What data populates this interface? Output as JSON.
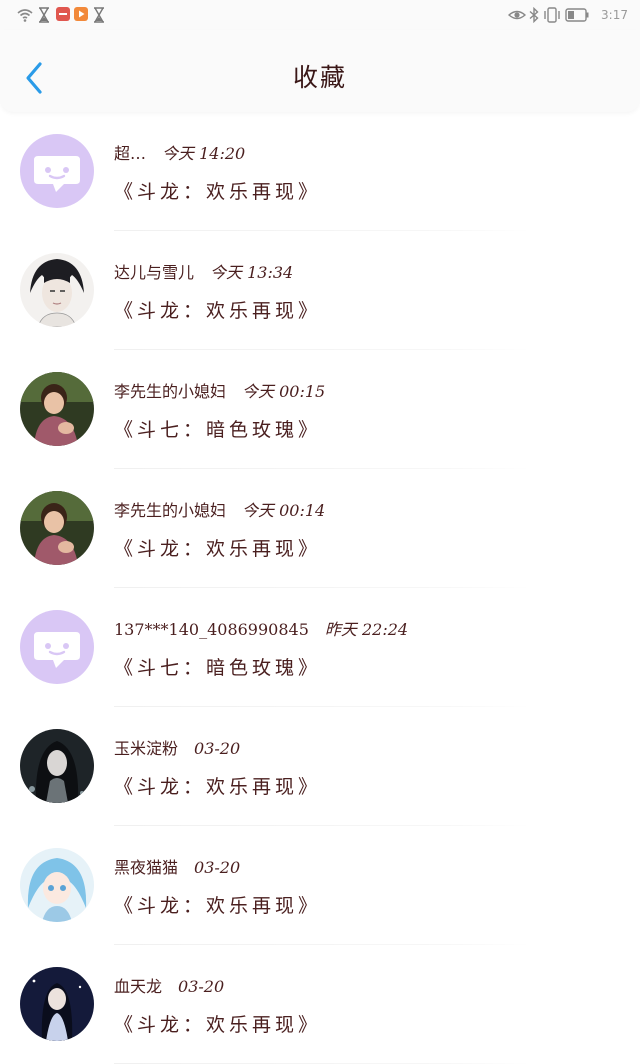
{
  "status_bar": {
    "time": "3:17",
    "icons": [
      "wifi-icon",
      "hourglass-icon",
      "app-red-icon",
      "video-play-icon",
      "hourglass-icon",
      "eye-icon",
      "bluetooth-icon",
      "vibrate-icon",
      "battery-icon"
    ]
  },
  "header": {
    "title": "收藏",
    "back_icon": "chevron-left-icon",
    "back_color": "#2a9be8"
  },
  "colors": {
    "chat_avatar_bg": "#d9c7f5",
    "text": "#4a1f1f"
  },
  "items": [
    {
      "name": "超…",
      "time": "今天 14:20",
      "work": "《斗龙：欢乐再现》",
      "avatar": "chat-bubble-avatar"
    },
    {
      "name": "达儿与雪儿",
      "time": "今天 13:34",
      "work": "《斗龙：欢乐再现》",
      "avatar": "sketch-boy-avatar"
    },
    {
      "name": "李先生的小媳妇",
      "time": "今天 00:15",
      "work": "《斗七：暗色玫瑰》",
      "avatar": "girl-photo-avatar"
    },
    {
      "name": "李先生的小媳妇",
      "time": "今天 00:14",
      "work": "《斗龙：欢乐再现》",
      "avatar": "girl-photo-avatar"
    },
    {
      "name": "137***140_4086990845",
      "time": "昨天 22:24",
      "work": "《斗七：暗色玫瑰》",
      "avatar": "chat-bubble-avatar"
    },
    {
      "name": "玉米淀粉",
      "time": "03-20",
      "work": "《斗龙：欢乐再现》",
      "avatar": "dark-anime-avatar"
    },
    {
      "name": "黑夜猫猫",
      "time": "03-20",
      "work": "《斗龙：欢乐再现》",
      "avatar": "blue-anime-avatar"
    },
    {
      "name": "血天龙",
      "time": "03-20",
      "work": "《斗龙：欢乐再现》",
      "avatar": "night-anime-avatar"
    }
  ]
}
